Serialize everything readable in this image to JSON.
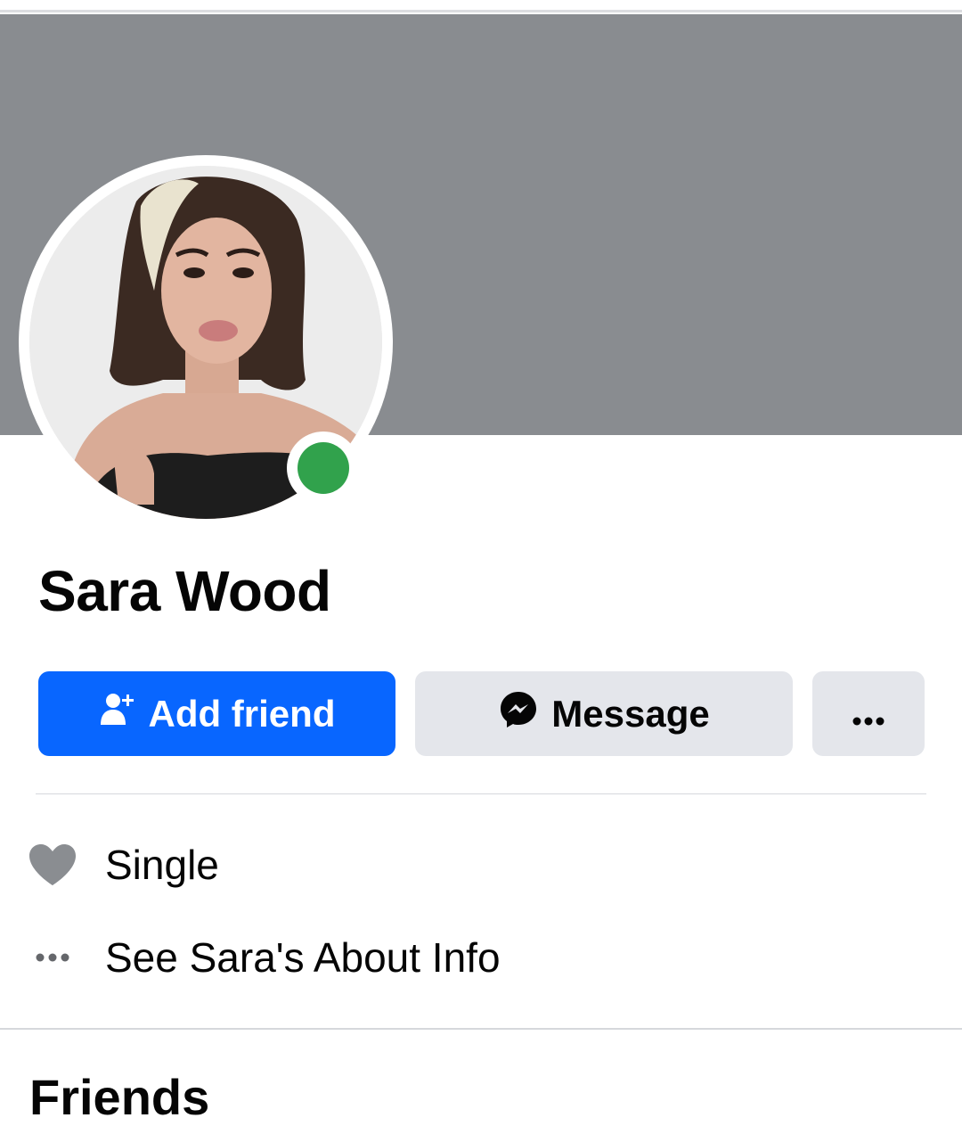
{
  "colors": {
    "cover": "#898c90",
    "primary_button": "#0866ff",
    "secondary_button": "#e4e6eb",
    "online_status": "#31a24c",
    "icon_gray": "#8a8d91"
  },
  "profile": {
    "name": "Sara Wood",
    "online": true
  },
  "actions": {
    "add_friend_label": "Add friend",
    "add_friend_icon": "add-user-icon",
    "message_label": "Message",
    "message_icon": "messenger-icon",
    "more_icon": "ellipsis-icon"
  },
  "details": [
    {
      "icon": "heart-icon",
      "text": "Single"
    },
    {
      "icon": "ellipsis-icon",
      "text": "See Sara's About Info"
    }
  ],
  "sections": {
    "friends_title": "Friends"
  }
}
